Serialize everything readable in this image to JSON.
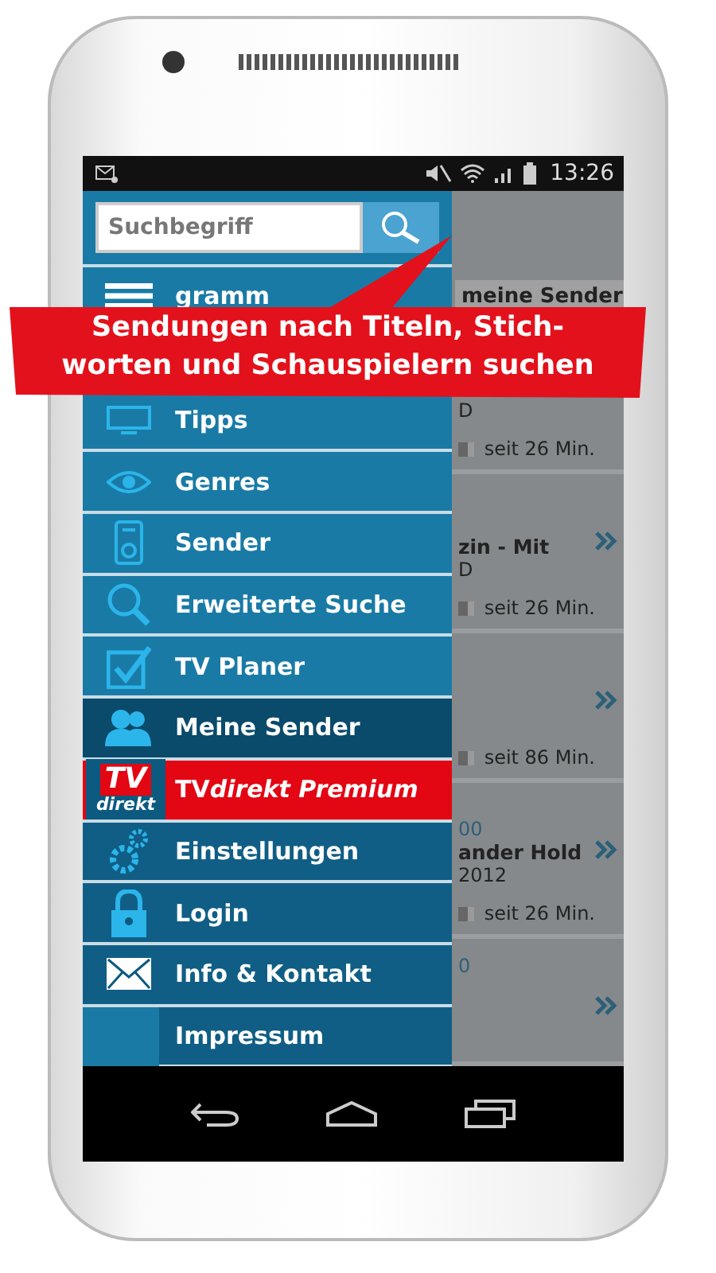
{
  "status_bar": {
    "time": "13:26"
  },
  "search": {
    "placeholder": "Suchbegriff"
  },
  "menu": [
    {
      "label": "gramm",
      "kind": "main",
      "selected": false
    },
    {
      "label": "Tipps",
      "kind": "main",
      "selected": false
    },
    {
      "label": "Genres",
      "kind": "main",
      "selected": false
    },
    {
      "label": "Sender",
      "kind": "main",
      "selected": false
    },
    {
      "label": "Erweiterte Suche",
      "kind": "main",
      "selected": false
    },
    {
      "label": "TV Planer",
      "kind": "main",
      "selected": false
    },
    {
      "label": "Meine Sender",
      "kind": "main",
      "selected": true
    },
    {
      "label": "TV",
      "suffix": "direkt Premium",
      "kind": "premium",
      "selected": false,
      "logo_top": "TV",
      "logo_bottom": "direkt"
    },
    {
      "label": "Einstellungen",
      "kind": "extra",
      "selected": false
    },
    {
      "label": "Login",
      "kind": "extra",
      "selected": false
    },
    {
      "label": "Info & Kontakt",
      "kind": "extra",
      "selected": false
    },
    {
      "label": "Impressum",
      "kind": "sub",
      "selected": false
    }
  ],
  "background": {
    "tab": "meine Sender",
    "entries": [
      {
        "lines": [
          "D"
        ],
        "since": "seit 26 Min.",
        "level": 0.6
      },
      {
        "title": "zin - Mit",
        "lines": [
          "D"
        ],
        "since": "seit 26 Min.",
        "level": 0.6,
        "chevron": true
      },
      {
        "since": "seit 86 Min.",
        "level": 0.6,
        "chevron": true
      },
      {
        "time": "00",
        "title": "ander Hold",
        "lines": [
          "2012"
        ],
        "since": "seit 26 Min.",
        "level": 0.6,
        "chevron": true
      },
      {
        "time": "0",
        "chevron": true
      }
    ]
  },
  "callout": {
    "text": "Sendungen nach Titeln, Stich-\nworten und Schauspielern suchen"
  }
}
